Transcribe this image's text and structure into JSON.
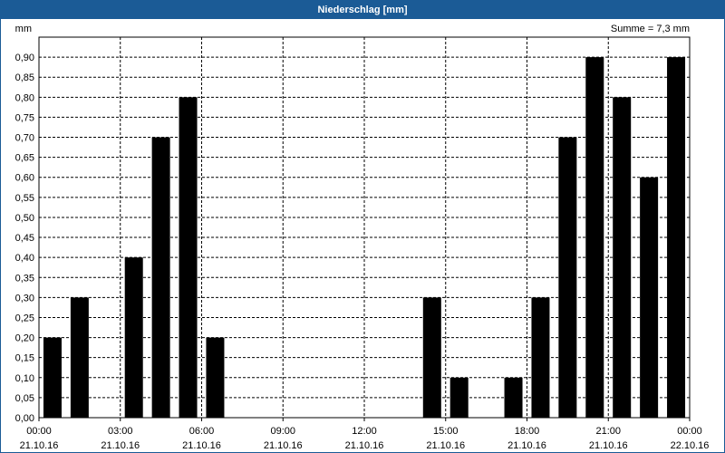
{
  "window": {
    "title": "Niederschlag [mm]"
  },
  "chart_data": {
    "type": "bar",
    "title": "Niederschlag [mm]",
    "ylabel": "mm",
    "sum_label": "Summe = 7,3 mm",
    "ylim": [
      0,
      0.95
    ],
    "y_ticks": [
      "0,00",
      "0,05",
      "0,10",
      "0,15",
      "0,20",
      "0,25",
      "0,30",
      "0,35",
      "0,40",
      "0,45",
      "0,50",
      "0,55",
      "0,60",
      "0,65",
      "0,70",
      "0,75",
      "0,80",
      "0,85",
      "0,90"
    ],
    "x_ticks": [
      {
        "time": "00:00",
        "date": "21.10.16"
      },
      {
        "time": "03:00",
        "date": "21.10.16"
      },
      {
        "time": "06:00",
        "date": "21.10.16"
      },
      {
        "time": "09:00",
        "date": "21.10.16"
      },
      {
        "time": "12:00",
        "date": "21.10.16"
      },
      {
        "time": "15:00",
        "date": "21.10.16"
      },
      {
        "time": "18:00",
        "date": "21.10.16"
      },
      {
        "time": "21:00",
        "date": "21.10.16"
      },
      {
        "time": "00:00",
        "date": "22.10.16"
      }
    ],
    "categories": [
      "00:00",
      "01:00",
      "02:00",
      "03:00",
      "04:00",
      "05:00",
      "06:00",
      "07:00",
      "08:00",
      "09:00",
      "10:00",
      "11:00",
      "12:00",
      "13:00",
      "14:00",
      "15:00",
      "16:00",
      "17:00",
      "18:00",
      "19:00",
      "20:00",
      "21:00",
      "22:00",
      "23:00"
    ],
    "values": [
      0.2,
      0.3,
      0,
      0.4,
      0.7,
      0.8,
      0.2,
      0,
      0,
      0,
      0,
      0,
      0,
      0,
      0.3,
      0.1,
      0,
      0.1,
      0.3,
      0.7,
      0.9,
      0.8,
      0.6,
      0.9
    ],
    "bar_color": "#000000",
    "grid": true
  }
}
